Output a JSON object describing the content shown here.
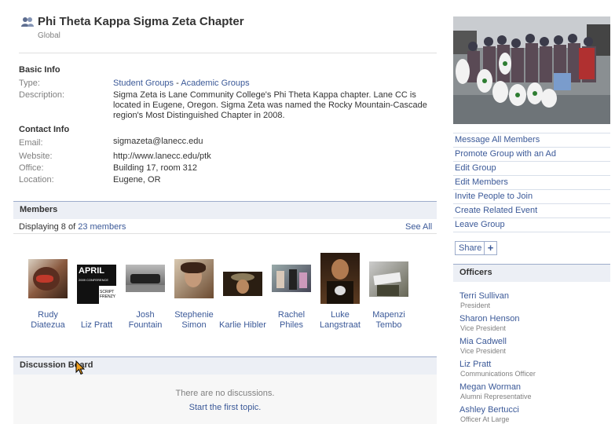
{
  "header": {
    "title": "Phi Theta Kappa Sigma Zeta Chapter",
    "subtitle": "Global"
  },
  "basic_info": {
    "heading": "Basic Info",
    "type_label": "Type:",
    "type_link1": "Student Groups",
    "type_sep": " - ",
    "type_link2": "Academic Groups",
    "description_label": "Description:",
    "description_line1": "Sigma Zeta is Lane Community College's Phi Theta Kappa chapter. Lane CC is",
    "description_line2": "located in Eugene, Oregon. Sigma Zeta was named the Rocky Mountain-Cascade",
    "description_line3": "region's Most Distinguished Chapter in 2008."
  },
  "contact_info": {
    "heading": "Contact Info",
    "email_label": "Email:",
    "email": "sigmazeta@lanecc.edu",
    "website_label": "Website:",
    "website": "http://www.lanecc.edu/ptk",
    "office_label": "Office:",
    "office": "Building 17, room 312",
    "location_label": "Location:",
    "location": "Eugene, OR"
  },
  "members": {
    "heading": "Members",
    "displaying_prefix": "Displaying 8 of ",
    "count_link": "23 members",
    "see_all": "See All",
    "list": [
      {
        "line1": "Rudy",
        "line2": "Diatezua"
      },
      {
        "line1": "Liz Pratt",
        "line2": ""
      },
      {
        "line1": "Josh",
        "line2": "Fountain"
      },
      {
        "line1": "Stephenie",
        "line2": "Simon"
      },
      {
        "line1": "Karlie Hibler",
        "line2": ""
      },
      {
        "line1": "Rachel",
        "line2": "Philes"
      },
      {
        "line1": "Luke",
        "line2": "Langstraat"
      },
      {
        "line1": "Mapenzi",
        "line2": "Tembo"
      }
    ],
    "liz_photo_text1": "APRIL",
    "liz_photo_text2": "2009 CONFERENCE",
    "liz_photo_text3": "SCRIPT FRENZY"
  },
  "discussion": {
    "heading": "Discussion Board",
    "empty": "There are no discussions.",
    "start_link": "Start the first topic."
  },
  "actions": {
    "items": [
      "Message All Members",
      "Promote Group with an Ad",
      "Edit Group",
      "Edit Members",
      "Invite People to Join",
      "Create Related Event",
      "Leave Group"
    ],
    "share_label": "Share",
    "share_plus": "+"
  },
  "officers": {
    "heading": "Officers",
    "list": [
      {
        "name": "Terri Sullivan",
        "role": "President"
      },
      {
        "name": "Sharon Henson",
        "role": "Vice President"
      },
      {
        "name": "Mia Cadwell",
        "role": "Vice President"
      },
      {
        "name": "Liz Pratt",
        "role": "Communications Officer"
      },
      {
        "name": "Megan Worman",
        "role": "Alumni Representative"
      },
      {
        "name": "Ashley Bertucci",
        "role": "Officer At Large"
      }
    ]
  },
  "colors": {
    "link": "#3b5998",
    "bar_bg": "#eceff5",
    "bar_border": "#9daccb"
  },
  "icons": [
    "group-icon",
    "mouse-cursor-icon",
    "plus-icon"
  ]
}
